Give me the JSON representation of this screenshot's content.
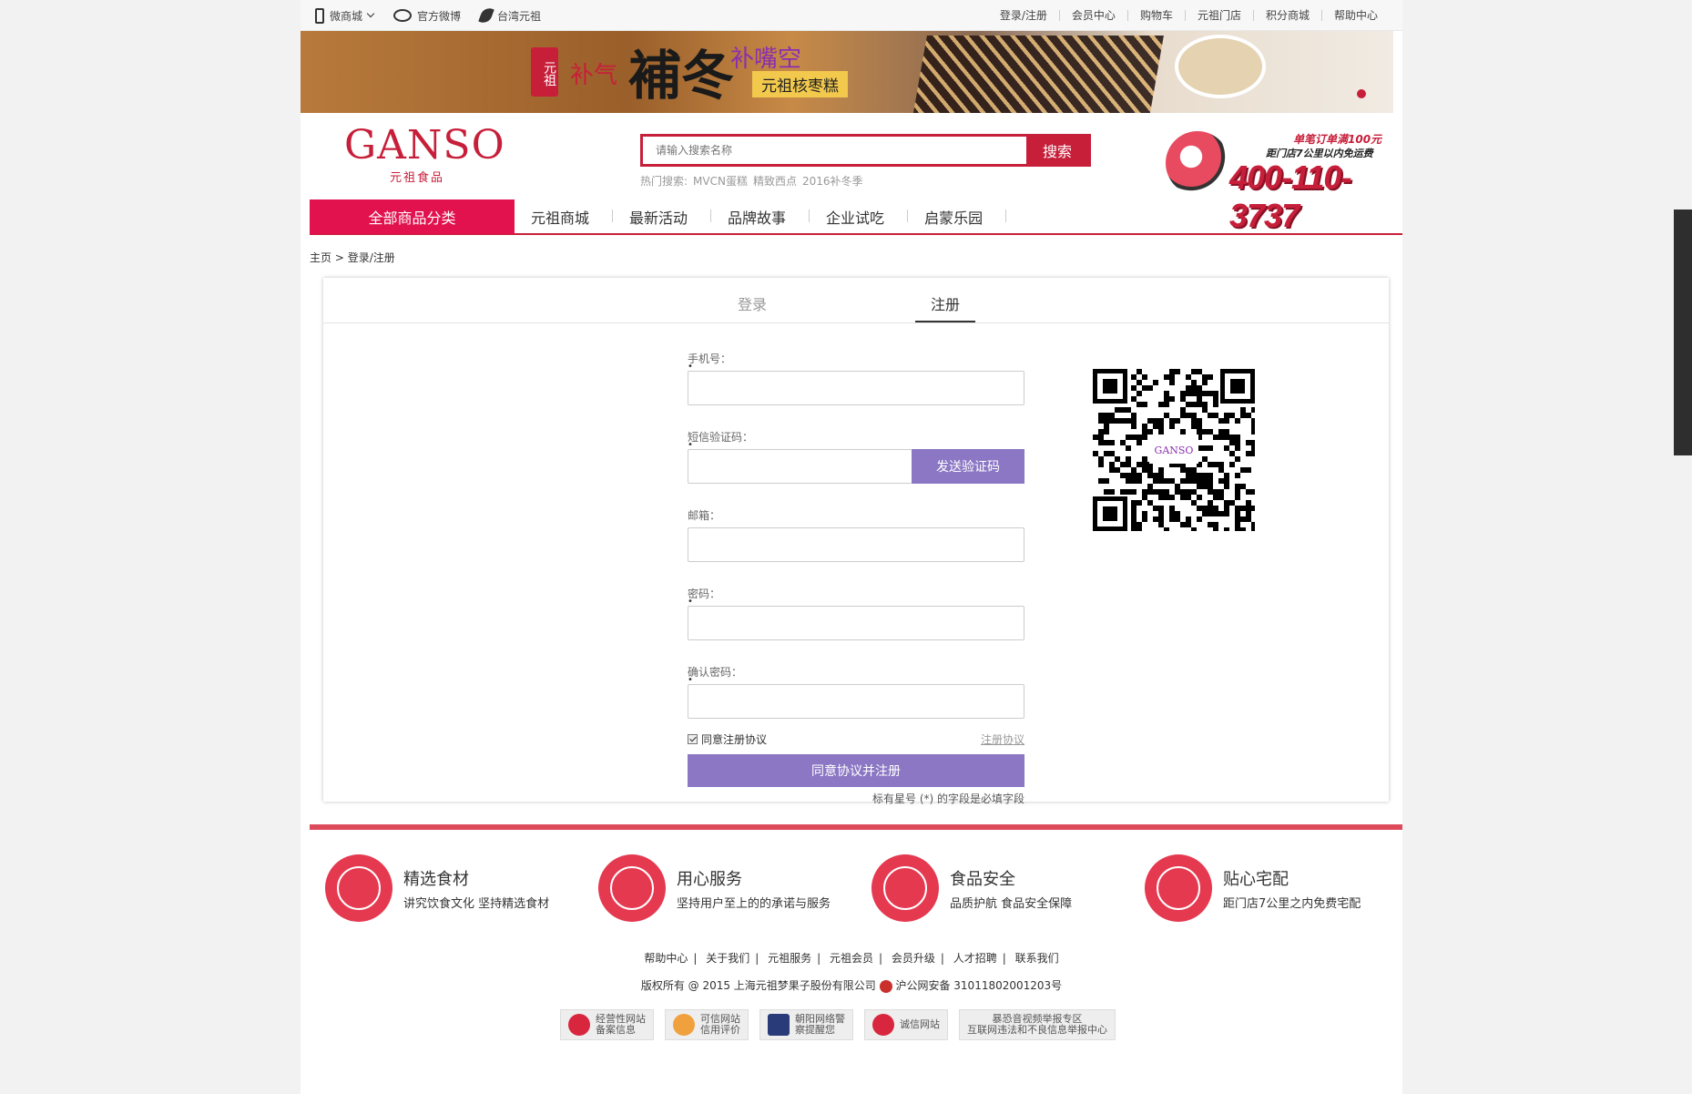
{
  "topbar": {
    "left": [
      {
        "label": "微商城",
        "icon": "phone-icon"
      },
      {
        "label": "官方微博",
        "icon": "weibo-icon"
      },
      {
        "label": "台湾元祖",
        "icon": "leaf-icon"
      }
    ],
    "right": [
      "登录/注册",
      "会员中心",
      "购物车",
      "元祖门店",
      "积分商城",
      "帮助中心"
    ]
  },
  "banner": {
    "seal": "元祖",
    "text1": "补气",
    "text2": "補冬",
    "text3": "补嘴空",
    "text4": "元祖核枣糕"
  },
  "header": {
    "logo_main": "GANSO",
    "logo_sub": "元祖食品",
    "search_placeholder": "请输入搜索名称",
    "search_button": "搜索",
    "hot_label": "热门搜索:",
    "hot_items": [
      "MVCN蛋糕",
      "精致西点",
      "2016补冬季"
    ],
    "promo_line1": "单笔订单满100元",
    "promo_line2": "距门店7公里以内免运费",
    "promo_phone": "400-110-3737"
  },
  "nav": {
    "all_categories": "全部商品分类",
    "items": [
      "元祖商城",
      "最新活动",
      "品牌故事",
      "企业试吃",
      "启蒙乐园"
    ]
  },
  "breadcrumb": {
    "home": "主页",
    "sep": ">",
    "current": "登录/注册"
  },
  "tabs": {
    "login": "登录",
    "register": "注册",
    "active": "register"
  },
  "form": {
    "phone_label": "手机号：",
    "sms_label": "短信验证码：",
    "send_code": "发送验证码",
    "email_label": "邮箱：",
    "password_label": "密码：",
    "confirm_label": "确认密码：",
    "agree_label": "同意注册协议",
    "agree_checked": true,
    "agreement_link": "注册协议",
    "submit": "同意协议并注册",
    "required_note": "标有星号 (*) 的字段是必填字段",
    "required_mark": "•"
  },
  "qr": {
    "center_text": "GANSO"
  },
  "features": [
    {
      "title": "精选食材",
      "desc": "讲究饮食文化 坚持精选食材",
      "icon": "ganso-laurel-icon"
    },
    {
      "title": "用心服务",
      "desc": "坚持用户至上的的承诺与服务",
      "icon": "heart-icon"
    },
    {
      "title": "食品安全",
      "desc": "品质护航 食品安全保障",
      "icon": "sgs-check-icon"
    },
    {
      "title": "贴心宅配",
      "desc": "距门店7公里之内免费宅配",
      "icon": "delivery-truck-icon"
    }
  ],
  "footer_links": [
    "帮助中心",
    "关于我们",
    "元祖服务",
    "元祖会员",
    "会员升级",
    "人才招聘",
    "联系我们"
  ],
  "copyright": "版权所有 @ 2015 上海元祖梦果子股份有限公司",
  "icp": "沪公网安备 31011802001203号",
  "badges": [
    {
      "l1": "经营性网站",
      "l2": "备案信息"
    },
    {
      "l1": "可信网站",
      "l2": "信用评价"
    },
    {
      "l1": "朝阳网络警",
      "l2": "察提醒您"
    },
    {
      "l1": "诚信网站",
      "l2": ""
    },
    {
      "l1": "暴恐音视频举报专区",
      "l2": "互联网违法和不良信息举报中心"
    }
  ],
  "colors": {
    "brand": "#c71f3a",
    "nav_active": "#e1124e",
    "button": "#8b77c4",
    "footer_line": "#dd4b5b"
  }
}
